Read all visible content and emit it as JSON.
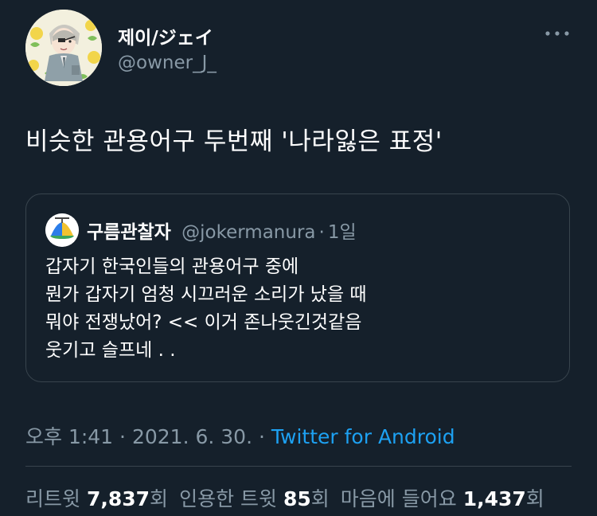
{
  "author": {
    "display_name": "제이/ジェイ",
    "handle": "@owner_J_"
  },
  "tweet": {
    "text": "비슷한 관용어구 두번째 '나라잃은 표정'"
  },
  "quote": {
    "name": "구름관찰자",
    "handle": "@jokermanura",
    "separator": "·",
    "time": "1일",
    "lines": [
      "갑자기 한국인들의 관용어구 중에",
      "뭔가 갑자기 엄청 시끄러운 소리가 났을 때",
      "뭐야 전쟁났어? << 이거 존나웃긴것같음",
      "웃기고 슬프네 . ."
    ]
  },
  "meta": {
    "time": "오후 1:41",
    "sep1": "·",
    "date": "2021. 6. 30.",
    "sep2": "·",
    "source": "Twitter for Android"
  },
  "stats": {
    "retweets_label": "리트윗",
    "retweets_count": "7,837",
    "retweets_unit": "회",
    "quotes_label": "인용한 트윗",
    "quotes_count": "85",
    "quotes_unit": "회",
    "likes_label": "마음에 들어요",
    "likes_count": "1,437",
    "likes_unit": "회"
  },
  "icons": {
    "more": "more-horizontal-icon"
  },
  "colors": {
    "background": "#15202b",
    "secondary_text": "#8899a6",
    "link": "#1da1f2",
    "border": "#38444d"
  }
}
